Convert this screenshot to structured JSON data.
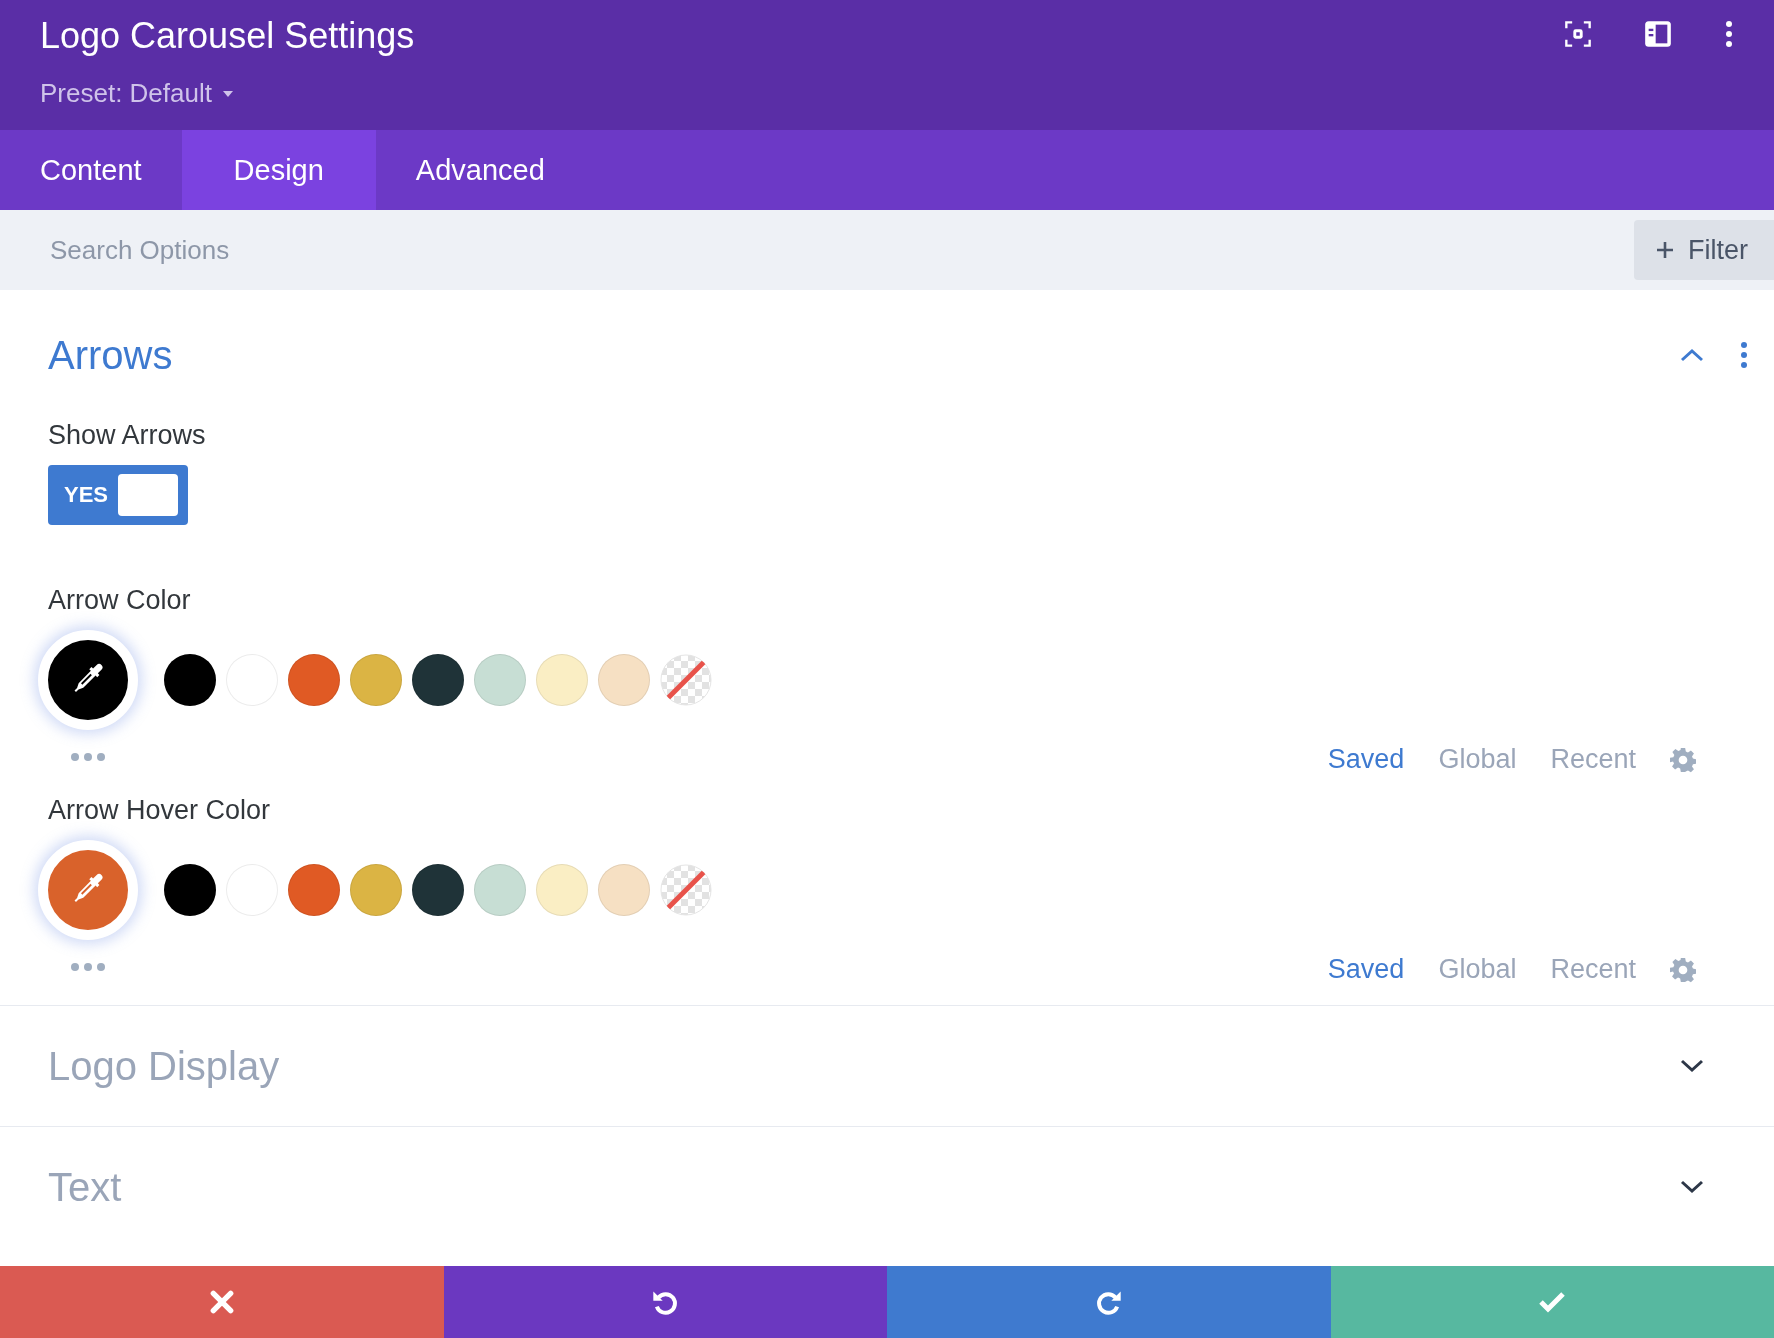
{
  "panel": {
    "title": "Logo Carousel Settings",
    "preset": "Preset: Default"
  },
  "tabs": [
    {
      "label": "Content",
      "selected": false
    },
    {
      "label": "Design",
      "selected": true
    },
    {
      "label": "Advanced",
      "selected": false
    }
  ],
  "search": {
    "placeholder": "Search Options"
  },
  "filter_button": {
    "label": "Filter"
  },
  "sections": [
    {
      "title": "Arrows",
      "expanded": true,
      "fields": [
        {
          "kind": "toggle",
          "label": "Show Arrows",
          "on": true,
          "value_label": "YES"
        },
        {
          "kind": "color",
          "label": "Arrow Color",
          "color": "#000000",
          "palette": [
            {
              "kind": "color",
              "color": "#000000"
            },
            {
              "kind": "color",
              "color": "#ffffff"
            },
            {
              "kind": "color",
              "color": "#e05a24"
            },
            {
              "kind": "color",
              "color": "#dbb444"
            },
            {
              "kind": "color",
              "color": "#1f3338"
            },
            {
              "kind": "color",
              "color": "#c7ded4"
            },
            {
              "kind": "color",
              "color": "#faeec4"
            },
            {
              "kind": "color",
              "color": "#f6e0c3"
            },
            {
              "kind": "none"
            }
          ],
          "sources": [
            {
              "label": "Saved",
              "selected": true
            },
            {
              "label": "Global",
              "selected": false
            },
            {
              "label": "Recent",
              "selected": false
            }
          ]
        },
        {
          "kind": "color",
          "label": "Arrow Hover Color",
          "color": "#d9622b",
          "palette": [
            {
              "kind": "color",
              "color": "#000000"
            },
            {
              "kind": "color",
              "color": "#ffffff"
            },
            {
              "kind": "color",
              "color": "#e05a24"
            },
            {
              "kind": "color",
              "color": "#dbb444"
            },
            {
              "kind": "color",
              "color": "#1f3338"
            },
            {
              "kind": "color",
              "color": "#c7ded4"
            },
            {
              "kind": "color",
              "color": "#faeec4"
            },
            {
              "kind": "color",
              "color": "#f6e0c3"
            },
            {
              "kind": "none"
            }
          ],
          "sources": [
            {
              "label": "Saved",
              "selected": true
            },
            {
              "label": "Global",
              "selected": false
            },
            {
              "label": "Recent",
              "selected": false
            }
          ]
        }
      ]
    },
    {
      "title": "Logo Display",
      "expanded": false
    },
    {
      "title": "Text",
      "expanded": false
    }
  ],
  "footer_buttons": [
    {
      "kind": "cancel"
    },
    {
      "kind": "undo"
    },
    {
      "kind": "redo"
    },
    {
      "kind": "save"
    }
  ]
}
